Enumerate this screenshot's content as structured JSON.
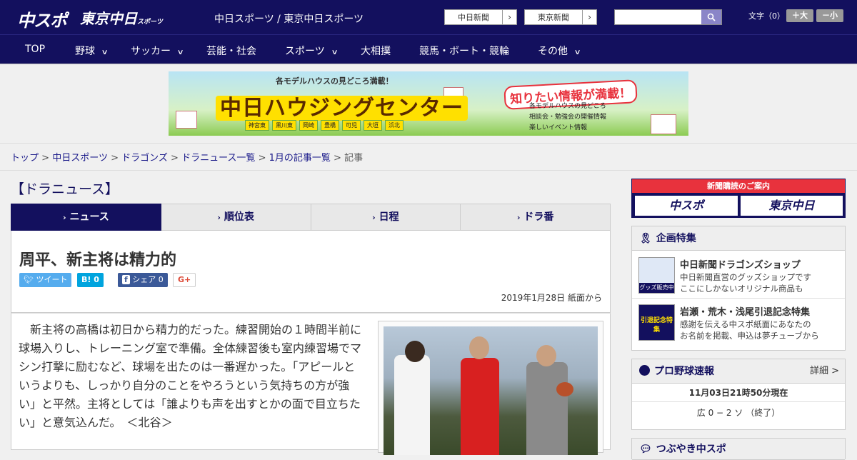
{
  "header": {
    "logo_main": "中スポ",
    "logo_tokyo": "東京中日",
    "logo_tokyo_small": "スポーツ",
    "tagline": "中日スポーツ / 東京中日スポーツ",
    "paper_links": [
      "中日新聞",
      "東京新聞"
    ],
    "search_placeholder": "",
    "font_size_label": "文字（0）",
    "font_bigger": "＋大",
    "font_smaller": "－小"
  },
  "nav": [
    {
      "label": "TOP",
      "has_menu": false
    },
    {
      "label": "野球",
      "has_menu": true
    },
    {
      "label": "サッカー",
      "has_menu": true
    },
    {
      "label": "芸能・社会",
      "has_menu": false
    },
    {
      "label": "スポーツ",
      "has_menu": true
    },
    {
      "label": "大相撲",
      "has_menu": false
    },
    {
      "label": "競馬・ボート・競輪",
      "has_menu": false
    },
    {
      "label": "その他",
      "has_menu": true
    }
  ],
  "banner": {
    "top": "各モデルハウスの見どころ満載！",
    "title": "中日ハウジングセンター",
    "catch": "知りたい情報が満載！",
    "list": [
      "各モデルハウスの見どころ",
      "相談会・勉強会の開催情報",
      "楽しいイベント情報"
    ],
    "towns": [
      "神宮東",
      "黒川東",
      "岡崎",
      "豊橋",
      "可児",
      "大垣",
      "浜北"
    ]
  },
  "breadcrumb": {
    "links": [
      "トップ",
      "中日スポーツ",
      "ドラゴンズ",
      "ドラニュース一覧",
      "1月の記事一覧"
    ],
    "current": "記事",
    "separator": ">"
  },
  "section_title": "【ドラニュース】",
  "tabs": [
    "ニュース",
    "順位表",
    "日程",
    "ドラ番"
  ],
  "article": {
    "headline": "周平、新主将は精力的",
    "share": {
      "tweet": "ツイート",
      "hatena": "B! 0",
      "facebook": "シェア 0",
      "gplus": "G+"
    },
    "date": "2019年1月28日 紙面から",
    "body": "新主将の高橋は初日から精力的だった。練習開始の１時間半前に球場入りし、トレーニング室で準備。全体練習後も室内練習場でマシン打撃に励むなど、球場を出たのは一番遅かった。「アピールというよりも、しっかり自分のことをやろうという気持ちの方が強い」と平然。主将としては「誰よりも声を出すとかの面で目立ちたい」と意気込んだ。　＜北谷＞"
  },
  "sidebar": {
    "subscribe_head": "新聞購読のご案内",
    "subscribe_logos": [
      "中スポ",
      "東京中日"
    ],
    "features_head": "企画特集",
    "features": [
      {
        "title": "中日新聞ドラゴンズショップ",
        "desc1": "中日新聞直営のグッズショップです",
        "desc2": "ここにしかないオリジナル商品も",
        "img_label": "グッズ販売中"
      },
      {
        "title": "岩瀬・荒木・浅尾引退記念特集",
        "desc1": "感謝を伝える中スポ紙面にあなたの",
        "desc2": "お名前を掲載、申込は夢チューブから",
        "img_label": "引退記念特集"
      }
    ],
    "score_head": "プロ野球速報",
    "score_more": "詳細 >",
    "score_time": "11月03日21時50分現在",
    "score_line": "広 0 − 2 ソ （終了）",
    "tsubuyaki_head": "つぶやき中スポ"
  },
  "colors": {
    "navy": "#13105e",
    "red": "#e8323d",
    "twitter": "#55acee",
    "hatena": "#00a4de",
    "facebook": "#3b5998"
  }
}
